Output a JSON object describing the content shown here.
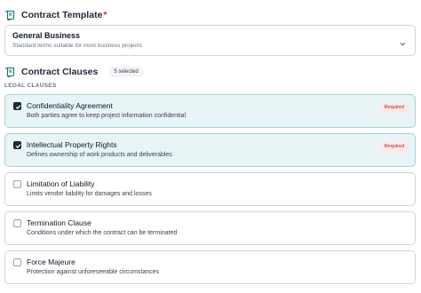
{
  "template": {
    "title": "Contract Template",
    "required_marker": "*",
    "selected_name": "General Business",
    "selected_desc": "Standard terms suitable for most business projects"
  },
  "clauses": {
    "title": "Contract Clauses",
    "count_label": "5 selected",
    "group_label": "LEGAL CLAUSES",
    "items": [
      {
        "title": "Confidentiality Agreement",
        "desc": "Both parties agree to keep project information confidential",
        "checked": true,
        "badge": "Required"
      },
      {
        "title": "Intellectual Property Rights",
        "desc": "Defines ownership of work products and deliverables",
        "checked": true,
        "badge": "Required"
      },
      {
        "title": "Limitation of Liability",
        "desc": "Limits vendor liability for damages and losses",
        "checked": false,
        "badge": ""
      },
      {
        "title": "Termination Clause",
        "desc": "Conditions under which the contract can be terminated",
        "checked": false,
        "badge": ""
      },
      {
        "title": "Force Majeure",
        "desc": "Protection against unforeseeable circumstances",
        "checked": false,
        "badge": ""
      }
    ]
  },
  "colors": {
    "selected_bg": "#e8f4f5",
    "required_badge_bg": "#fde8e8",
    "required_badge_text": "#b91c1c",
    "accent_icon": "#0f766e"
  },
  "icons": {
    "section": "scroll-icon",
    "dropdown": "chevron-down-icon",
    "check": "check-icon"
  }
}
